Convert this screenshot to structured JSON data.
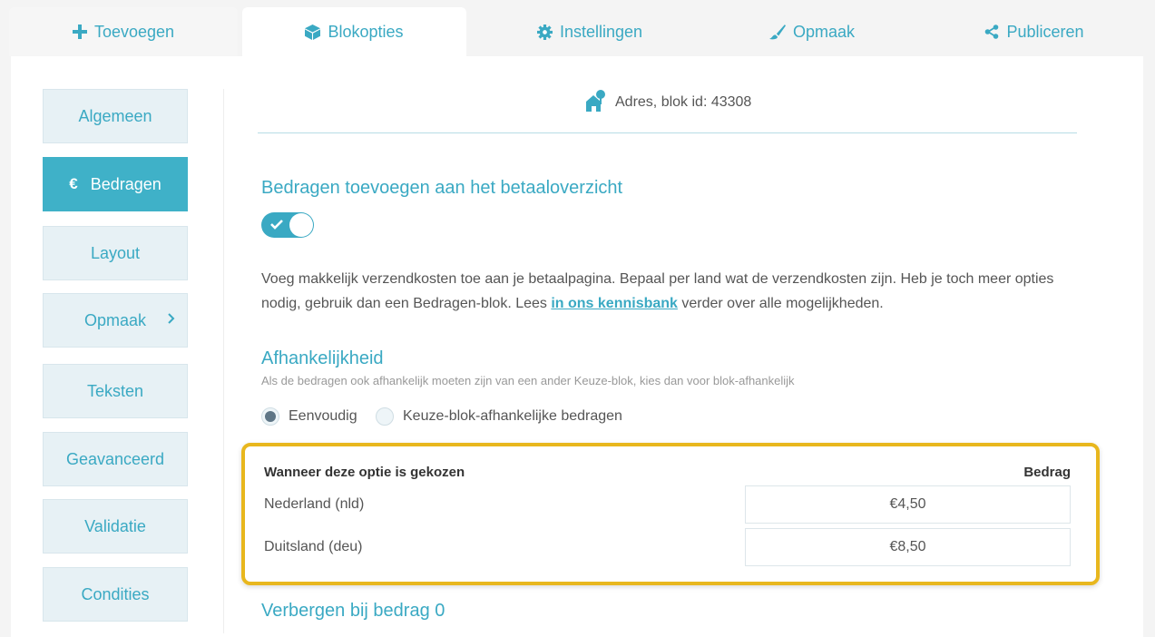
{
  "tabs": [
    {
      "label": "Toevoegen",
      "icon": "plus-icon"
    },
    {
      "label": "Blokopties",
      "icon": "cube-icon"
    },
    {
      "label": "Instellingen",
      "icon": "gear-icon"
    },
    {
      "label": "Opmaak",
      "icon": "brush-icon"
    },
    {
      "label": "Publiceren",
      "icon": "share-icon"
    }
  ],
  "active_tab": "Blokopties",
  "sidebar": {
    "items": [
      {
        "label": "Algemeen"
      },
      {
        "label": "Bedragen",
        "icon": "euro-icon",
        "active": true
      },
      {
        "label": "Layout"
      },
      {
        "label": "Opmaak",
        "icon": "chevron-right-icon"
      },
      {
        "label": "Teksten"
      },
      {
        "label": "Geavanceerd"
      },
      {
        "label": "Validatie"
      },
      {
        "label": "Condities"
      }
    ]
  },
  "header": {
    "icon": "address-icon",
    "text": "Adres, blok id: 43308"
  },
  "section1": {
    "title": "Bedragen toevoegen aan het betaaloverzicht",
    "toggle_on": true,
    "description_part1": "Voeg makkelijk verzendkosten toe aan je betaalpagina. Bepaal per land wat de verzendkosten zijn. Heb je toch meer opties nodig, gebruik dan een Bedragen-blok. Lees ",
    "link_text": "in ons kennisbank",
    "description_part2": " verder over alle mogelijkheden."
  },
  "dependency": {
    "title": "Afhankelijkheid",
    "note": "Als de bedragen ook afhankelijk moeten zijn van een ander Keuze-blok, kies dan voor blok-afhankelijk",
    "options": [
      {
        "label": "Eenvoudig",
        "checked": true
      },
      {
        "label": "Keuze-blok-afhankelijke bedragen",
        "checked": false
      }
    ]
  },
  "amounts_table": {
    "col_option": "Wanneer deze optie is gekozen",
    "col_amount": "Bedrag",
    "rows": [
      {
        "label": "Nederland (nld)",
        "amount": "€4,50"
      },
      {
        "label": "Duitsland (deu)",
        "amount": "€8,50"
      }
    ]
  },
  "section3": {
    "title": "Verbergen bij bedrag 0"
  },
  "colors": {
    "accent": "#3aa9c3",
    "highlight": "#e8b71e",
    "sidebar_bg": "#e7f1f5"
  }
}
